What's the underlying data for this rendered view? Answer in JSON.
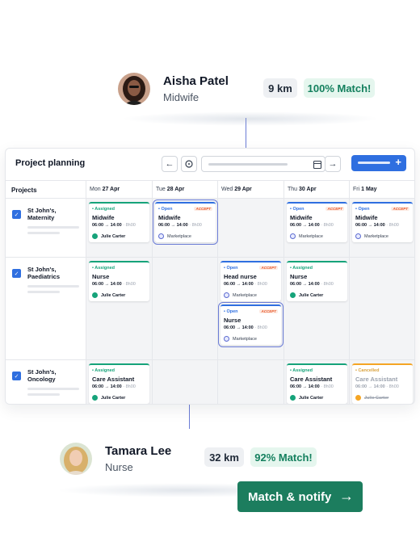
{
  "candidate_top": {
    "name": "Aisha Patel",
    "role": "Midwife",
    "distance": "9 km",
    "match": "100% Match!"
  },
  "candidate_bottom": {
    "name": "Tamara Lee",
    "role": "Nurse",
    "distance": "32 km",
    "match": "92% Match!"
  },
  "planner": {
    "title": "Project planning",
    "projects_header": "Projects",
    "days": [
      {
        "dow": "Mon",
        "date": "27 Apr"
      },
      {
        "dow": "Tue",
        "date": "28 Apr"
      },
      {
        "dow": "Wed",
        "date": "29 Apr"
      },
      {
        "dow": "Thu",
        "date": "30 Apr"
      },
      {
        "dow": "Fri",
        "date": "1 May"
      }
    ],
    "projects": [
      "St John's, Maternity",
      "St John's, Paediatrics",
      "St John's, Oncology"
    ],
    "status": {
      "open": "• Open",
      "assigned": "• Assigned",
      "cancelled": "• Cancelled"
    },
    "accept_badge": "ACCEPT",
    "time": "06:00 → 14:00",
    "hours": "· 8h00",
    "marketplace": "Marketplace",
    "roles": {
      "midwife": "Midwife",
      "nurse": "Nurse",
      "head_nurse": "Head nurse",
      "care_assistant": "Care Assistant"
    },
    "assignees": {
      "julie": "Julie Carter"
    }
  },
  "cta": {
    "label": "Match & notify"
  },
  "colors": {
    "primary": "#2f6fe0",
    "assigned": "#16a37a",
    "cancelled": "#f5a524",
    "accept": "#e8572a",
    "cta": "#1c7d5e",
    "connector": "#6b7cd6"
  },
  "icons": [
    "arrow-left-icon",
    "clock-icon",
    "calendar-icon",
    "arrow-right-icon",
    "plus-icon",
    "person-icon",
    "globe-icon",
    "check-calendar-icon"
  ]
}
